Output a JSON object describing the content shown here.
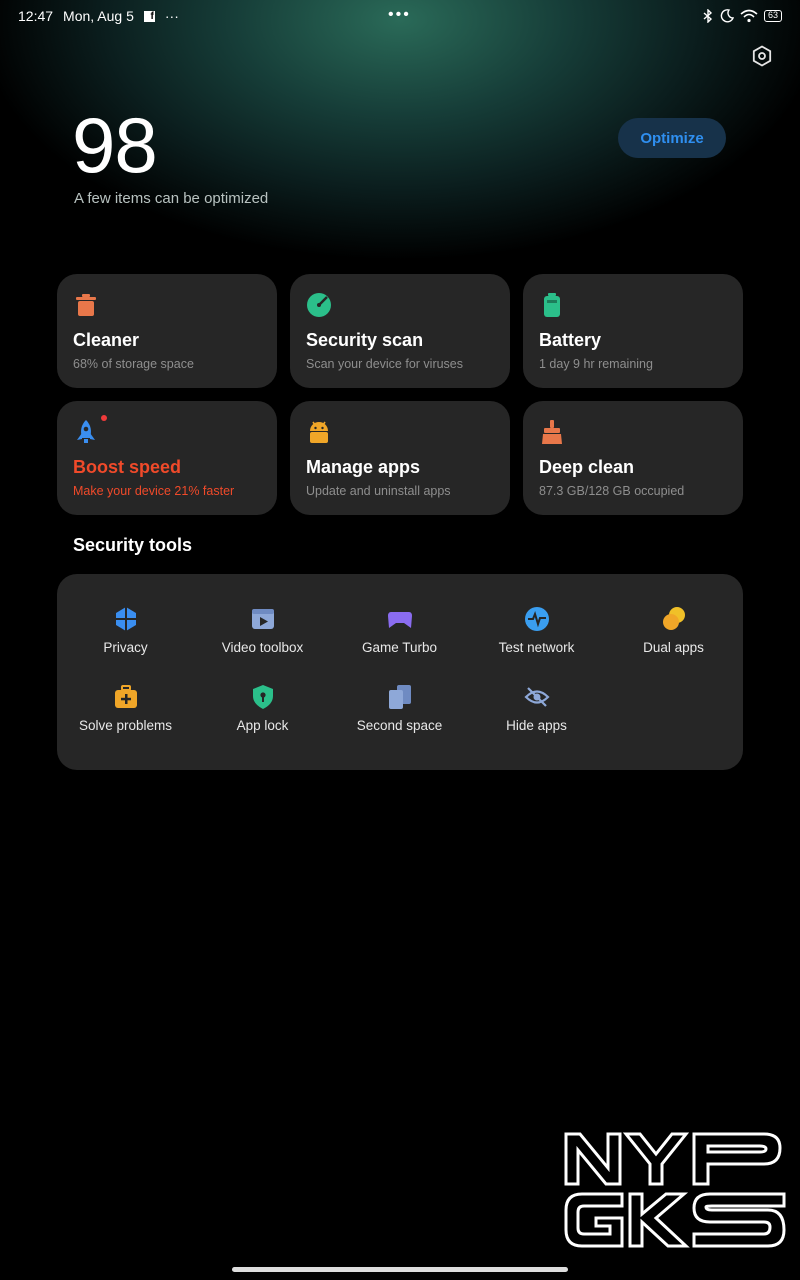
{
  "status_bar": {
    "time": "12:47",
    "date": "Mon, Aug 5",
    "overflow": "···",
    "center_dots": "•••",
    "battery": "63",
    "icons": [
      "facebook-icon",
      "bluetooth-icon",
      "moon-icon",
      "wifi-icon",
      "battery-icon"
    ]
  },
  "header": {
    "score": "98",
    "subtitle": "A few items can be optimized",
    "optimize_label": "Optimize",
    "settings_icon": "settings-icon"
  },
  "cards": [
    {
      "title": "Cleaner",
      "subtitle": "68% of storage space",
      "icon": "trash-icon",
      "color": "#e8774a"
    },
    {
      "title": "Security scan",
      "subtitle": "Scan your device for viruses",
      "icon": "radar-icon",
      "color": "#2bbf8a"
    },
    {
      "title": "Battery",
      "subtitle": "1 day 9 hr  remaining",
      "icon": "battery-icon",
      "color": "#2bbf8a"
    },
    {
      "title": "Boost speed",
      "subtitle": "Make your device 21% faster",
      "icon": "rocket-icon",
      "color": "#3a8ef0",
      "alert_color": "#f04a2a"
    },
    {
      "title": "Manage apps",
      "subtitle": "Update and uninstall apps",
      "icon": "android-icon",
      "color": "#f0a628"
    },
    {
      "title": "Deep clean",
      "subtitle": "87.3 GB/128 GB occupied",
      "icon": "broom-icon",
      "color": "#e8774a"
    }
  ],
  "security_tools": {
    "title": "Security tools",
    "items": [
      {
        "label": "Privacy",
        "icon": "privacy-icon",
        "color": "#3a8ef0"
      },
      {
        "label": "Video toolbox",
        "icon": "video-icon",
        "color": "#8ea8d8"
      },
      {
        "label": "Game Turbo",
        "icon": "gamepad-icon",
        "color": "#8a6cf0"
      },
      {
        "label": "Test network",
        "icon": "network-icon",
        "color": "#3a9ef0"
      },
      {
        "label": "Dual apps",
        "icon": "dual-apps-icon",
        "color": "#f0a628"
      },
      {
        "label": "Solve problems",
        "icon": "medkit-icon",
        "color": "#f0a628"
      },
      {
        "label": "App lock",
        "icon": "lock-shield-icon",
        "color": "#2bbf8a"
      },
      {
        "label": "Second space",
        "icon": "second-space-icon",
        "color": "#8ea8d8"
      },
      {
        "label": "Hide apps",
        "icon": "eye-off-icon",
        "color": "#8ea8d8"
      }
    ]
  },
  "watermark": {
    "line1": "NYP",
    "line2": "GKS"
  }
}
